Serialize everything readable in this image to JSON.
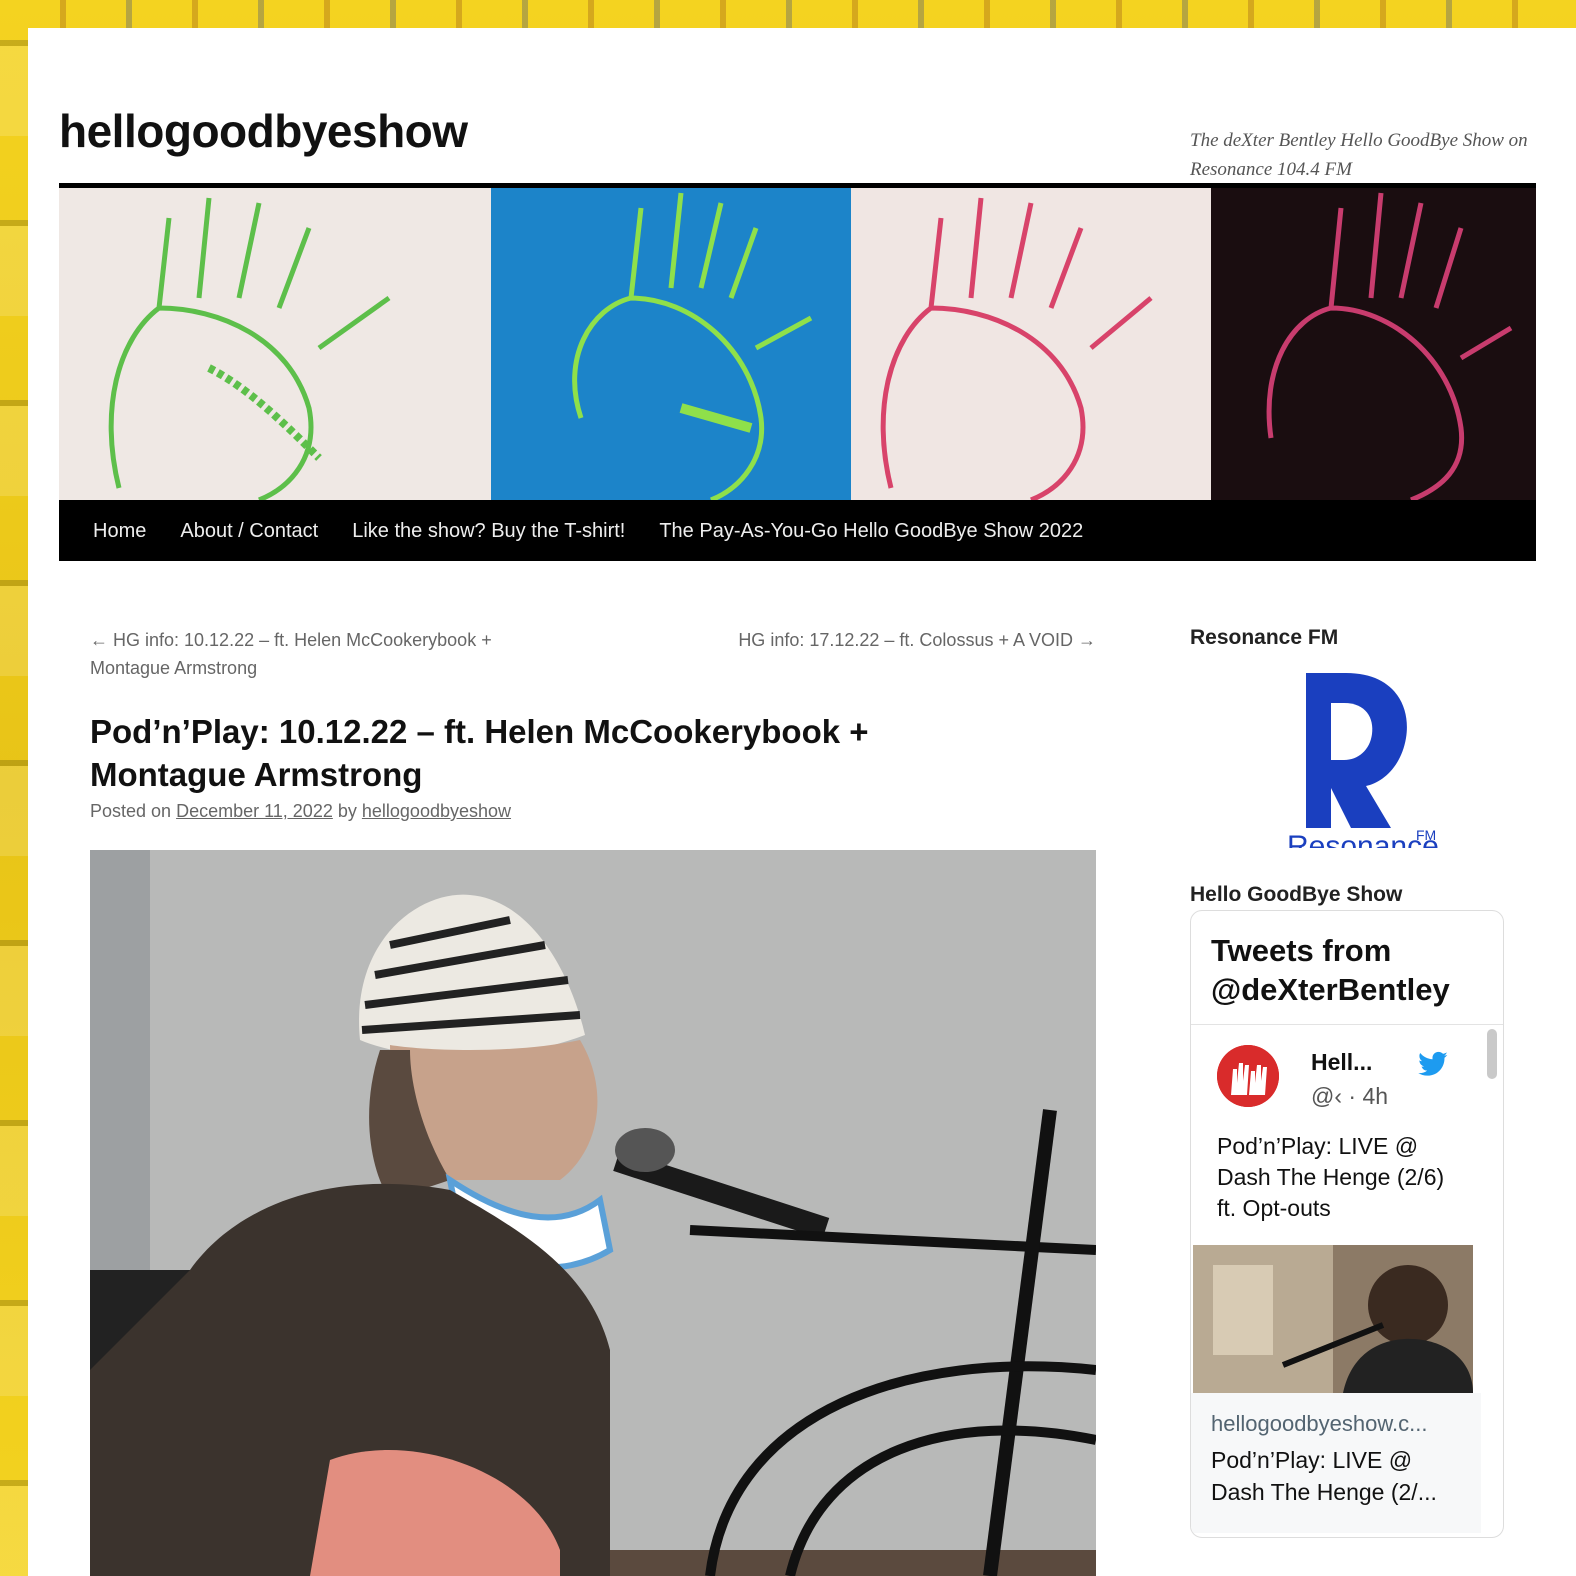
{
  "site": {
    "title": "hellogoodbyeshow",
    "tagline": "The deXter Bentley Hello GoodBye Show on Resonance 104.4 FM"
  },
  "nav": {
    "items": [
      {
        "label": "Home"
      },
      {
        "label": "About / Contact"
      },
      {
        "label": "Like the show? Buy the T-shirt!"
      },
      {
        "label": "The Pay-As-You-Go Hello GoodBye Show 2022"
      }
    ]
  },
  "post": {
    "prev_link": "← HG info: 10.12.22 – ft. Helen McCookerybook + Montague Armstrong",
    "next_link": "HG info: 17.12.22 – ft. Colossus + A VOID →",
    "title": "Pod’n’Play: 10.12.22 – ft. Helen McCookerybook + Montague Armstrong",
    "meta_prefix": "Posted on",
    "date": "December 11, 2022",
    "meta_by": "by",
    "author": "hellogoodbyeshow"
  },
  "sidebar": {
    "resonance_title": "Resonance FM",
    "resonance_logo_text": "Resonance",
    "resonance_logo_sup": "FM",
    "twitter_widget_title": "Hello GoodBye Show",
    "twitter": {
      "header": "Tweets from @deXterBentley",
      "name": "Hell...",
      "handle": "@‹ · 4h",
      "text": "Pod’n’Play: LIVE @ Dash The Henge (2/6) ft. Opt-outs",
      "link_domain": "hellogoodbyeshow.c...",
      "link_title": "Pod’n’Play: LIVE @ Dash The Henge (2/..."
    }
  },
  "colors": {
    "nav_bg": "#000000",
    "resonance_blue": "#1a3fbf",
    "twitter_blue": "#1d9bf0"
  }
}
